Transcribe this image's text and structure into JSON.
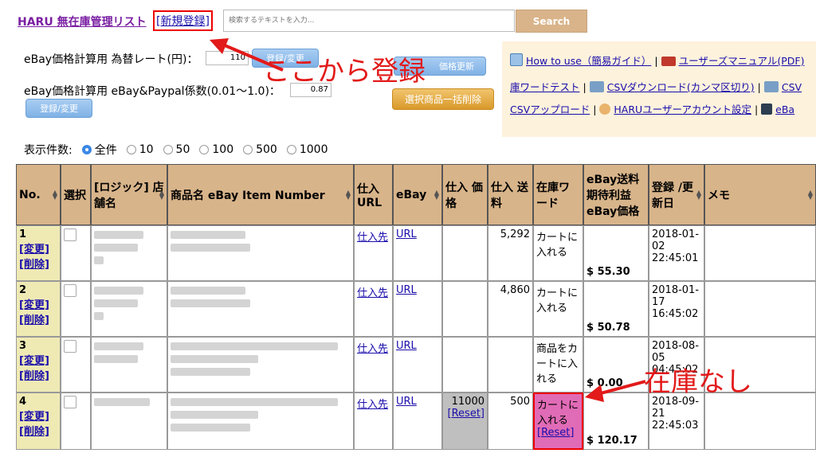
{
  "header": {
    "title": "HARU 無在庫管理リスト",
    "new_register": "[新規登録]",
    "search_placeholder": "検索するテキストを入力...",
    "search_button": "Search"
  },
  "settings": {
    "rate_label": "eBay価格計算用 為替レート(円)：",
    "rate_value": "110",
    "rate_button": "登録/変更",
    "coef_label": "eBay価格計算用 eBay&Paypal係数(0.01〜1.0)：",
    "coef_value": "0.87",
    "coef_button": "登録/変更",
    "price_update_button": "価格更新",
    "bulk_delete_button": "選択商品一括削除"
  },
  "links": {
    "howto": "How to use（簡易ガイド）",
    "manual": "ユーザーズマニュアル(PDF)",
    "word_test": "庫ワードテスト",
    "csv_download": "CSVダウンロード(カンマ区切り)",
    "csv_cut": "CSV",
    "csv_upload": "CSVアップロード",
    "account": "HARUユーザーアカウント設定",
    "ebay": "eBa",
    "sep": "|"
  },
  "annotations": {
    "register_here": "ここから登録",
    "out_of_stock": "在庫なし",
    "accent": "#e21a1a"
  },
  "display_count": {
    "label": "表示件数:",
    "options": [
      "全件",
      "10",
      "50",
      "100",
      "500",
      "1000"
    ],
    "selected": "全件"
  },
  "table": {
    "headers": [
      "No.",
      "選択",
      "[ロジック] 店舗名",
      "商品名 eBay Item Number",
      "仕入 URL",
      "eBay",
      "仕入 価格",
      "仕入 送料",
      "在庫ワード",
      "eBay送料 期待利益 eBay価格",
      "登録 /更新日",
      "メモ"
    ],
    "rows": [
      {
        "no": "1",
        "edit": "[変更]",
        "del": "[削除]",
        "src": "仕入先",
        "ebay": "URL",
        "price": "",
        "ship": "5,292",
        "word": "カートに入れる",
        "reset": "",
        "ebay_price": "$ 55.30",
        "date": "2018-01-02 22:45:01"
      },
      {
        "no": "2",
        "edit": "[変更]",
        "del": "[削除]",
        "src": "仕入先",
        "ebay": "URL",
        "price": "",
        "ship": "4,860",
        "word": "カートに入れる",
        "reset": "",
        "ebay_price": "$ 50.78",
        "date": "2018-01-17 16:45:02"
      },
      {
        "no": "3",
        "edit": "[変更]",
        "del": "[削除]",
        "src": "仕入先",
        "ebay": "URL",
        "price": "",
        "ship": "",
        "word": "商品をカートに入れる",
        "reset": "",
        "ebay_price": "$ 0.00",
        "date": "2018-08-05 04:45:02"
      },
      {
        "no": "4",
        "edit": "[変更]",
        "del": "[削除]",
        "src": "仕入先",
        "ebay": "URL",
        "price": "11000",
        "price_reset": "[Reset]",
        "ship": "500",
        "word": "カートに入れる",
        "reset": "[Reset]",
        "ebay_price": "$ 120.17",
        "date": "2018-09-21 22:45:03"
      }
    ]
  },
  "colors": {
    "header_bg": "#d8b48a",
    "no_cell_bg": "#efeab4",
    "out_of_stock_bg": "#e06bb6",
    "panel_bg": "#fdf2dc"
  }
}
